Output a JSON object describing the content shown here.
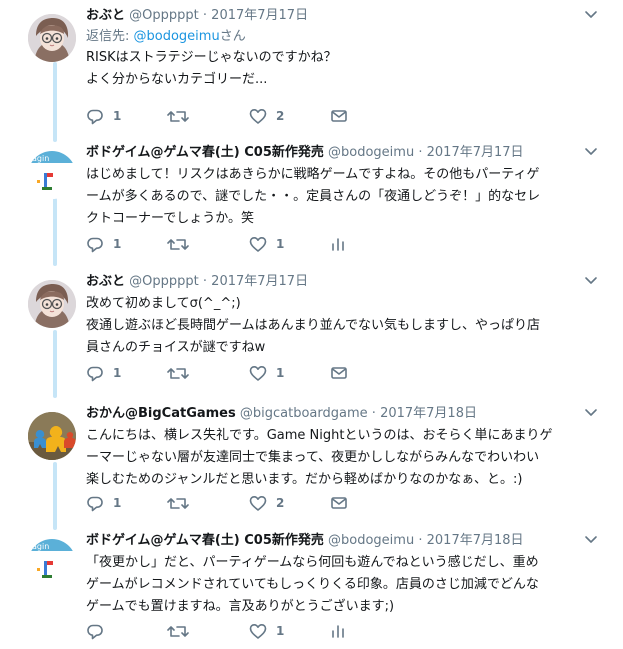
{
  "tweets": [
    {
      "name": "おぶと",
      "handle": "@Opppppt",
      "date": "2017年7月17日",
      "reply_prefix": "返信先: ",
      "reply_mention": "@bodogeimu",
      "reply_suffix": "さん",
      "lines": [
        "RISKはストラテジーじゃないのですかね？",
        "よく分からないカテゴリーだ..."
      ],
      "counts": {
        "reply": "1",
        "retweet": "",
        "like": "2"
      },
      "last_icon": "envelope-icon",
      "avatar": "face-avatar"
    },
    {
      "name": "ボドゲイム@ゲムマ春(土) C05新作発売",
      "handle": "@bodogeimu",
      "date": "2017年7月17日",
      "lines": [
        "はじめまして！リスクはあきらかに戦略ゲームですよね。その他もパーティゲ",
        "ームが多くあるので、謎でした・・。定員さんの「夜通しどうぞ！」的なセレ",
        "クトコーナーでしょうか。笑"
      ],
      "counts": {
        "reply": "1",
        "retweet": "",
        "like": "1"
      },
      "last_icon": "analytics-icon",
      "avatar": "logo-avatar"
    },
    {
      "name": "おぶと",
      "handle": "@Opppppt",
      "date": "2017年7月17日",
      "lines": [
        "改めて初めましてσ(^_^;)",
        "夜通し遊ぶほど長時間ゲームはあんまり並んでない気もしますし、やっぱり店",
        "員さんのチョイスが謎ですねw"
      ],
      "counts": {
        "reply": "1",
        "retweet": "",
        "like": "1"
      },
      "last_icon": "envelope-icon",
      "avatar": "face-avatar"
    },
    {
      "name": "おかん@BigCatGames",
      "handle": "@bigcatboardgame",
      "date": "2017年7月18日",
      "lines": [
        "こんにちは、横レス失礼です。Game Nightというのは、おそらく単にあまりゲ",
        "ーマーじゃない層が友達同士で集まって、夜更かししながらみんなでわいわい",
        "楽しむためのジャンルだと思います。だから軽めばかりなのかなぁ、と。:)"
      ],
      "counts": {
        "reply": "1",
        "retweet": "",
        "like": "2"
      },
      "last_icon": "envelope-icon",
      "avatar": "meeple-avatar"
    },
    {
      "name": "ボドゲイム@ゲムマ春(土) C05新作発売",
      "handle": "@bodogeimu",
      "date": "2017年7月18日",
      "lines": [
        "「夜更かし」だと、パーティゲームなら何回も遊んでねという感じだし、重め",
        "ゲームがレコメンドされていてもしっくりくる印象。店員のさじ加減でどんな",
        "ゲームでも置けますね。言及ありがとうございます;)"
      ],
      "counts": {
        "reply": "",
        "retweet": "",
        "like": "1"
      },
      "last_icon": "analytics-icon",
      "avatar": "logo-avatar"
    }
  ],
  "colors": {
    "line": "#c6e5f7",
    "icon": "#657786",
    "link": "#1b95e0"
  }
}
